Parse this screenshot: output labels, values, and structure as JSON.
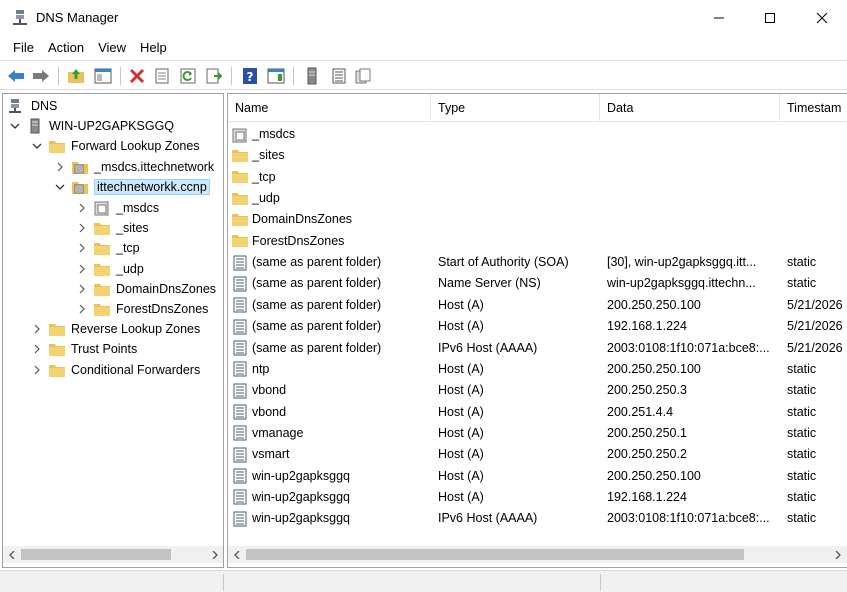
{
  "window": {
    "title": "DNS Manager",
    "icon": "dns-server-icon"
  },
  "menu": [
    "File",
    "Action",
    "View",
    "Help"
  ],
  "toolbar": {
    "buttons": [
      "back-icon",
      "forward-icon",
      "up-folder-icon",
      "show-hide-tree-icon",
      "delete-icon",
      "properties-icon",
      "refresh-icon",
      "export-list-icon",
      "help-icon",
      "action-pane-icon",
      "server-icon",
      "zone-icon",
      "record-icon"
    ]
  },
  "tree": {
    "root": "DNS",
    "server": "WIN-UP2GAPKSGGQ",
    "forward_zones": "Forward Lookup Zones",
    "zone_msdcs": "_msdcs.ittechnetwork",
    "zone_main": "ittechnetworkk.ccnp",
    "sub_msdcs": "_msdcs",
    "sub_sites": "_sites",
    "sub_tcp": "_tcp",
    "sub_udp": "_udp",
    "sub_domaindns": "DomainDnsZones",
    "sub_forestdns": "ForestDnsZones",
    "reverse_zones": "Reverse Lookup Zones",
    "trust_points": "Trust Points",
    "conditional_forwarders": "Conditional Forwarders"
  },
  "table": {
    "headers": {
      "name": "Name",
      "type": "Type",
      "data": "Data",
      "timestamp": "Timestam"
    },
    "rows": [
      {
        "icon": "delegated-folder-icon",
        "name": "_msdcs",
        "type": "",
        "data": "",
        "ts": ""
      },
      {
        "icon": "folder-icon",
        "name": "_sites",
        "type": "",
        "data": "",
        "ts": ""
      },
      {
        "icon": "folder-icon",
        "name": "_tcp",
        "type": "",
        "data": "",
        "ts": ""
      },
      {
        "icon": "folder-icon",
        "name": "_udp",
        "type": "",
        "data": "",
        "ts": ""
      },
      {
        "icon": "folder-icon",
        "name": "DomainDnsZones",
        "type": "",
        "data": "",
        "ts": ""
      },
      {
        "icon": "folder-icon",
        "name": "ForestDnsZones",
        "type": "",
        "data": "",
        "ts": ""
      },
      {
        "icon": "record-icon",
        "name": "(same as parent folder)",
        "type": "Start of Authority (SOA)",
        "data": "[30], win-up2gapksggq.itt...",
        "ts": "static"
      },
      {
        "icon": "record-icon",
        "name": "(same as parent folder)",
        "type": "Name Server (NS)",
        "data": "win-up2gapksggq.ittechn...",
        "ts": "static"
      },
      {
        "icon": "record-icon",
        "name": "(same as parent folder)",
        "type": "Host (A)",
        "data": "200.250.250.100",
        "ts": "5/21/2026"
      },
      {
        "icon": "record-icon",
        "name": "(same as parent folder)",
        "type": "Host (A)",
        "data": "192.168.1.224",
        "ts": "5/21/2026"
      },
      {
        "icon": "record-icon",
        "name": "(same as parent folder)",
        "type": "IPv6 Host (AAAA)",
        "data": "2003:0108:1f10:071a:bce8:...",
        "ts": "5/21/2026"
      },
      {
        "icon": "record-icon",
        "name": "ntp",
        "type": "Host (A)",
        "data": "200.250.250.100",
        "ts": "static"
      },
      {
        "icon": "record-icon",
        "name": "vbond",
        "type": "Host (A)",
        "data": "200.250.250.3",
        "ts": "static"
      },
      {
        "icon": "record-icon",
        "name": "vbond",
        "type": "Host (A)",
        "data": "200.251.4.4",
        "ts": "static"
      },
      {
        "icon": "record-icon",
        "name": "vmanage",
        "type": "Host (A)",
        "data": "200.250.250.1",
        "ts": "static"
      },
      {
        "icon": "record-icon",
        "name": "vsmart",
        "type": "Host (A)",
        "data": "200.250.250.2",
        "ts": "static"
      },
      {
        "icon": "record-icon",
        "name": "win-up2gapksggq",
        "type": "Host (A)",
        "data": "200.250.250.100",
        "ts": "static"
      },
      {
        "icon": "record-icon",
        "name": "win-up2gapksggq",
        "type": "Host (A)",
        "data": "192.168.1.224",
        "ts": "static"
      },
      {
        "icon": "record-icon",
        "name": "win-up2gapksggq",
        "type": "IPv6 Host (AAAA)",
        "data": "2003:0108:1f10:071a:bce8:...",
        "ts": "static"
      }
    ]
  },
  "colors": {
    "selection": "#cce8ff",
    "folder": "#e8c25a",
    "border": "#a0a0a0",
    "toolbar_blue": "#2b6cc4",
    "delete_red": "#d0312d"
  }
}
